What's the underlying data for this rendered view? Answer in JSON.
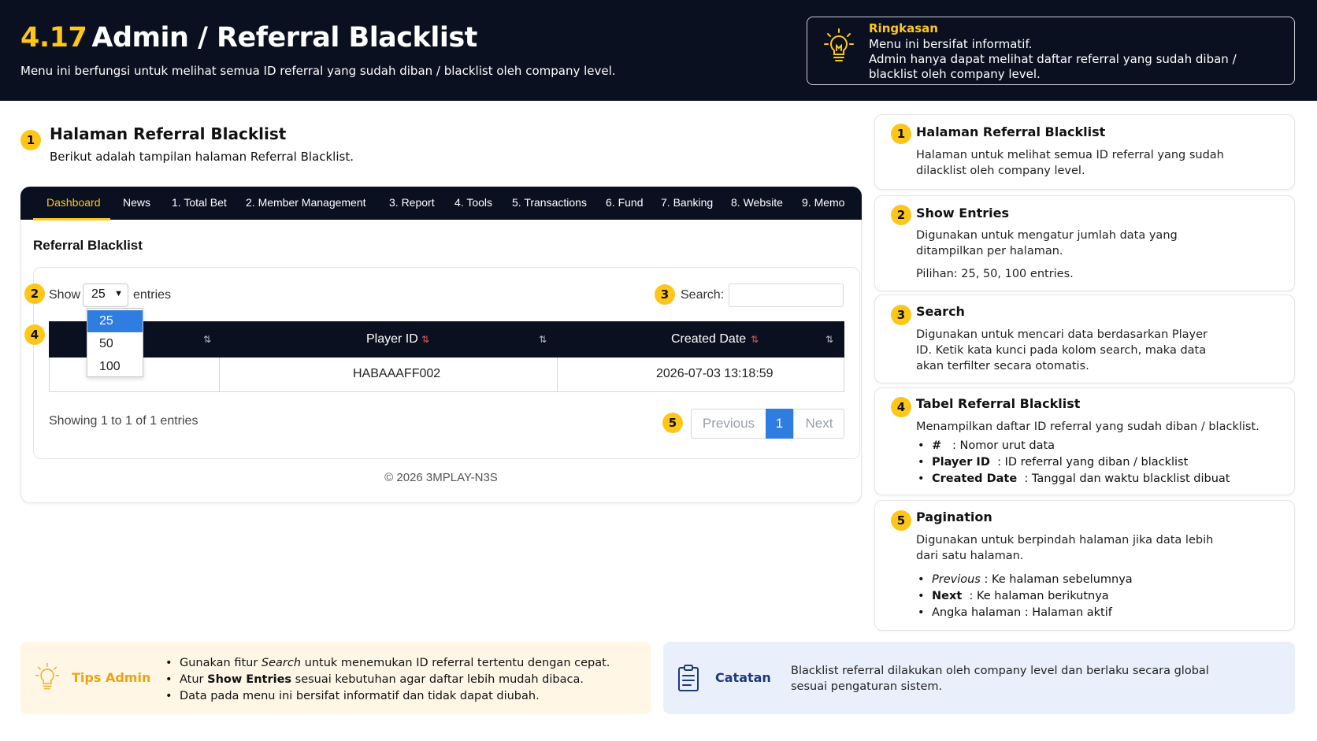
{
  "header": {
    "number": "4.17",
    "title": "Admin / Referral Blacklist",
    "subtitle": "Menu ini berfungsi untuk melihat semua ID referral yang sudah diban / blacklist oleh company level.",
    "summary": {
      "title": "Ringkasan",
      "line1": "Menu ini bersifat informatif.",
      "line2": "Admin hanya dapat melihat daftar referral yang sudah diban / blacklist oleh company level."
    }
  },
  "section": {
    "badge": "1",
    "title": "Halaman Referral Blacklist",
    "subtitle": "Berikut adalah tampilan halaman Referral Blacklist."
  },
  "nav": [
    "Dashboard",
    "News",
    "1. Total Bet",
    "2. Member Management",
    "3. Report",
    "4. Tools",
    "5. Transactions",
    "6. Fund",
    "7. Banking",
    "8. Website",
    "9. Memo"
  ],
  "page": {
    "title": "Referral Blacklist",
    "show_label": "Show",
    "show_value": "25",
    "entries_label": "entries",
    "search_label": "Search:",
    "search_placeholder": "",
    "dropdown_options": [
      "25",
      "50",
      "100"
    ],
    "columns": [
      "",
      "Player ID",
      "Created Date"
    ],
    "rows": [
      {
        "player_id": "HABAAAFF002",
        "created_date": "2026-07-03 13:18:59"
      }
    ],
    "showing": "Showing 1 to 1 of 1 entries",
    "pager": {
      "prev": "Previous",
      "current": "1",
      "next": "Next"
    },
    "copyright": "© 2026 3MPLAY-N3S"
  },
  "badges": {
    "b2": "2",
    "b3": "3",
    "b4": "4",
    "b5": "5"
  },
  "cards": [
    {
      "badge": "1",
      "title": "Halaman Referral Blacklist",
      "text": "Halaman untuk melihat semua ID referral yang sudah dilacklist oleh company level."
    },
    {
      "badge": "2",
      "title": "Show Entries",
      "text": "Digunakan untuk mengatur jumlah data yang ditampilkan per halaman.",
      "extra": "Pilihan: 25, 50, 100 entries."
    },
    {
      "badge": "3",
      "title": "Search",
      "text": "Digunakan untuk mencari data berdasarkan Player ID. Ketik kata kunci pada kolom search, maka data akan terfilter secara otomatis."
    },
    {
      "badge": "4",
      "title": "Tabel Referral Blacklist",
      "text": "Menampilkan daftar ID referral yang sudah diban / blacklist.",
      "items": [
        {
          "key": "#",
          "val": ": Nomor urut data"
        },
        {
          "key": "Player ID",
          "val": ": ID referral yang diban / blacklist"
        },
        {
          "key": "Created Date",
          "val": ": Tanggal dan waktu blacklist dibuat"
        }
      ]
    },
    {
      "badge": "5",
      "title": "Pagination",
      "text": "Digunakan untuk berpindah halaman jika data lebih dari satu halaman.",
      "items": [
        {
          "key": "Previous",
          "val": ": Ke halaman sebelumnya"
        },
        {
          "key": "Next",
          "val": ": Ke halaman berikutnya"
        },
        {
          "key": "",
          "val": "Angka halaman : Halaman aktif"
        }
      ]
    }
  ],
  "tips": {
    "title": "Tips Admin",
    "items": [
      {
        "pre": "Gunakan fitur ",
        "em": "Search",
        "post": " untuk menemukan ID referral tertentu dengan cepat."
      },
      {
        "pre": "Atur ",
        "em": "Show Entries",
        "post": " sesuai kebutuhan agar daftar lebih mudah dibaca."
      },
      {
        "pre": "Data pada menu ini bersifat informatif dan tidak dapat diubah.",
        "em": "",
        "post": ""
      }
    ]
  },
  "notes": {
    "title": "Catatan",
    "text": "Blacklist referral dilakukan oleh company level dan berlaku secara global sesuai pengaturan sistem."
  },
  "colors": {
    "accent": "#ffc61a",
    "dark": "#0b1020",
    "primary": "#2f7de1",
    "tips_bg": "#fff6e6",
    "notes_bg": "#eaf0fb"
  }
}
